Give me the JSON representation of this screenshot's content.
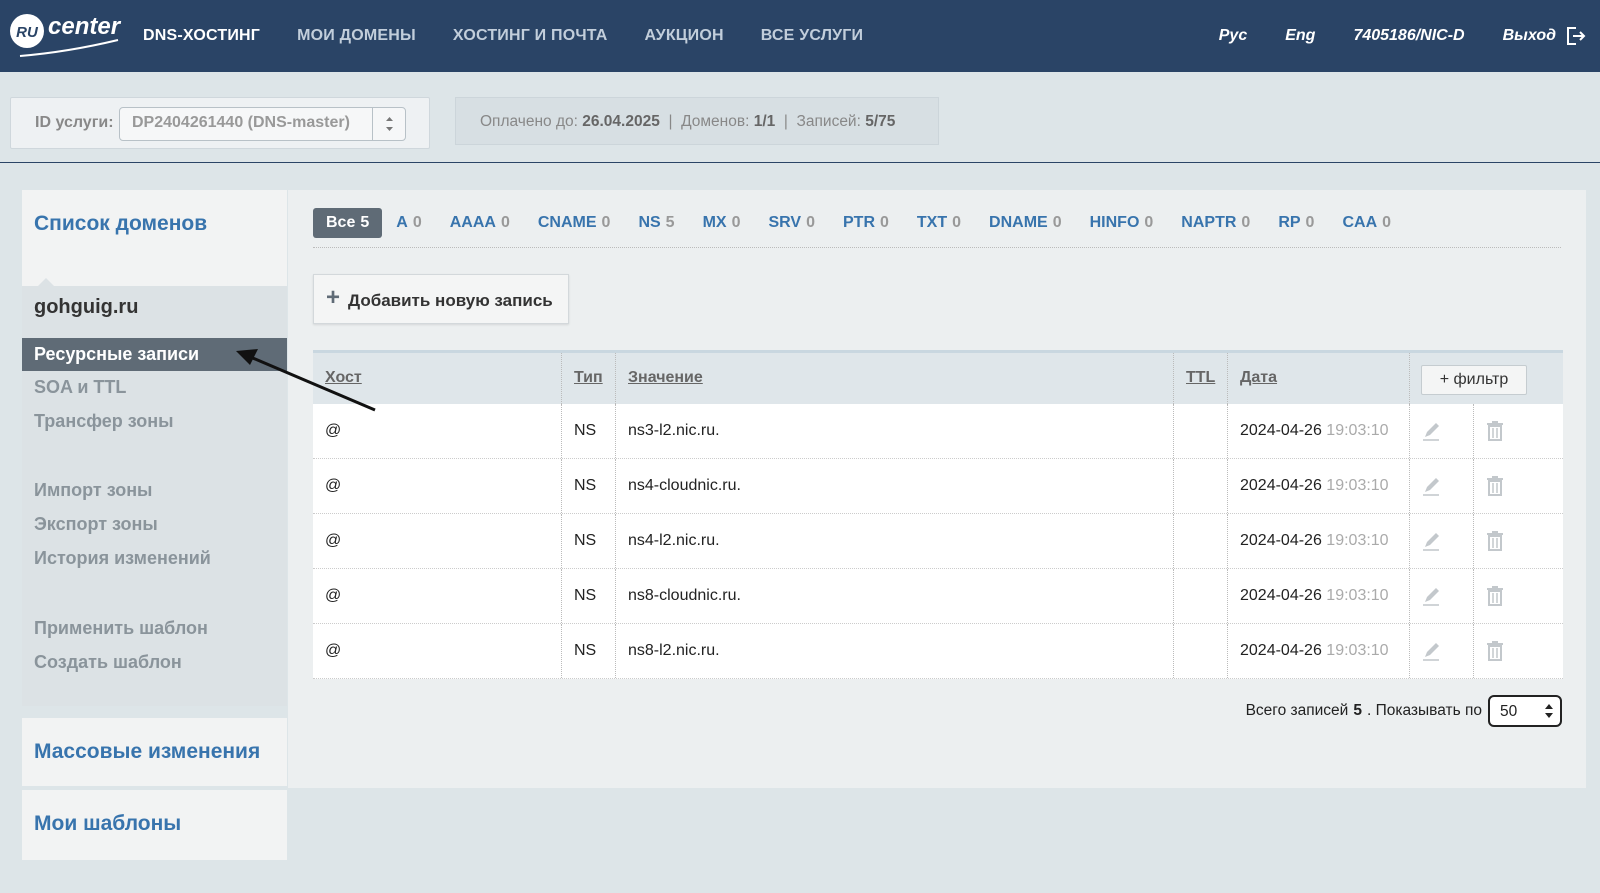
{
  "header": {
    "logo_text": "RU center",
    "nav": [
      "DNS-ХОСТИНГ",
      "МОИ ДОМЕНЫ",
      "ХОСТИНГ И ПОЧТА",
      "АУКЦИОН",
      "ВСЕ УСЛУГИ"
    ],
    "lang_ru": "Рус",
    "lang_en": "Eng",
    "account": "7405186/NIC-D",
    "logout": "Выход"
  },
  "service": {
    "label": "ID услуги:",
    "selected": "DP2404261440 (DNS-master)",
    "paid_label": "Оплачено до:",
    "paid_until": "26.04.2025",
    "domains_label": "Доменов:",
    "domains": "1/1",
    "records_label": "Записей:",
    "records": "5/75"
  },
  "sidebar": {
    "domains_title": "Список доменов",
    "domain": "gohguig.ru",
    "items": [
      "Ресурсные записи",
      "SOA и TTL",
      "Трансфер зоны",
      "Импорт зоны",
      "Экспорт зоны",
      "История изменений",
      "Применить шаблон",
      "Создать шаблон"
    ],
    "mass_title": "Массовые изменения",
    "templates_title": "Мои шаблоны"
  },
  "filters": [
    {
      "label": "Все",
      "count": "5"
    },
    {
      "label": "A",
      "count": "0"
    },
    {
      "label": "AAAA",
      "count": "0"
    },
    {
      "label": "CNAME",
      "count": "0"
    },
    {
      "label": "NS",
      "count": "5"
    },
    {
      "label": "MX",
      "count": "0"
    },
    {
      "label": "SRV",
      "count": "0"
    },
    {
      "label": "PTR",
      "count": "0"
    },
    {
      "label": "TXT",
      "count": "0"
    },
    {
      "label": "DNAME",
      "count": "0"
    },
    {
      "label": "HINFO",
      "count": "0"
    },
    {
      "label": "NAPTR",
      "count": "0"
    },
    {
      "label": "RP",
      "count": "0"
    },
    {
      "label": "CAA",
      "count": "0"
    }
  ],
  "add_button": "Добавить новую запись",
  "table": {
    "headers": {
      "host": "Хост",
      "type": "Тип",
      "value": "Значение",
      "ttl": "TTL",
      "date": "Дата"
    },
    "filter_button": "+ фильтр",
    "rows": [
      {
        "host": "@",
        "type": "NS",
        "value": "ns3-l2.nic.ru.",
        "ttl": "",
        "date": "2024-04-26",
        "time": "19:03:10"
      },
      {
        "host": "@",
        "type": "NS",
        "value": "ns4-cloudnic.ru.",
        "ttl": "",
        "date": "2024-04-26",
        "time": "19:03:10"
      },
      {
        "host": "@",
        "type": "NS",
        "value": "ns4-l2.nic.ru.",
        "ttl": "",
        "date": "2024-04-26",
        "time": "19:03:10"
      },
      {
        "host": "@",
        "type": "NS",
        "value": "ns8-cloudnic.ru.",
        "ttl": "",
        "date": "2024-04-26",
        "time": "19:03:10"
      },
      {
        "host": "@",
        "type": "NS",
        "value": "ns8-l2.nic.ru.",
        "ttl": "",
        "date": "2024-04-26",
        "time": "19:03:10"
      }
    ]
  },
  "footer": {
    "total_label": "Всего записей",
    "total": "5",
    "per_page_label": ". Показывать по",
    "per_page": "50"
  },
  "colors": {
    "header_bg": "#2a4466",
    "link": "#3874ad",
    "active_bg": "#5f6b76"
  }
}
